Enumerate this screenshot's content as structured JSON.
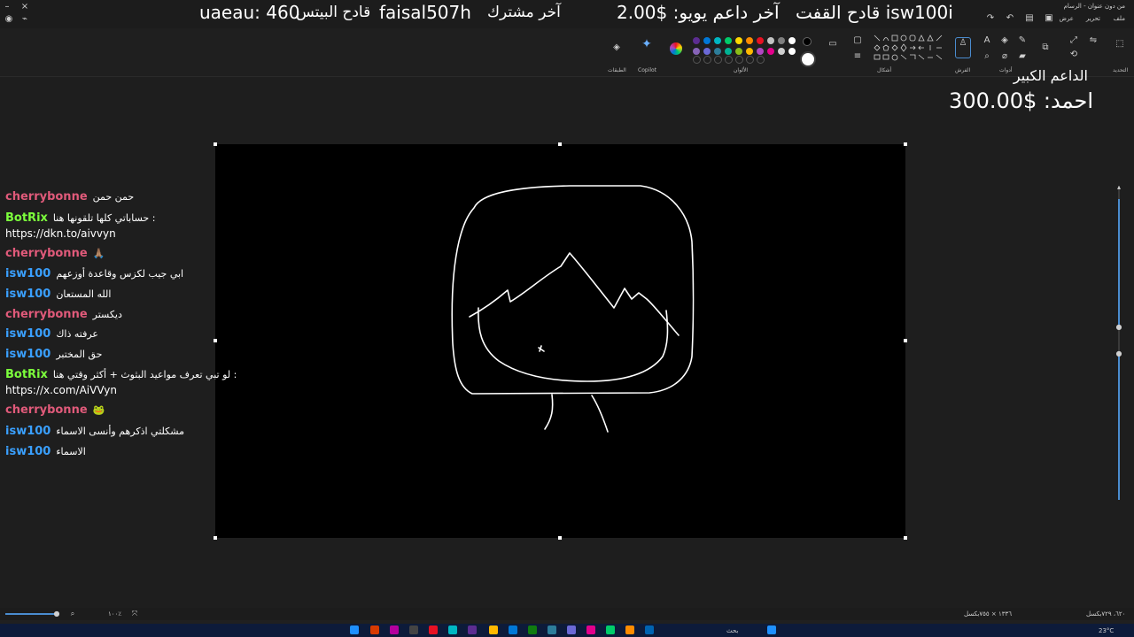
{
  "ticker": {
    "item1": "قادح القفت isw100i",
    "item2": "آخر داعم  يويو: $2.00",
    "item3": "آخر مشترك",
    "item4": "faisal507h",
    "item5": "قادح البيتس",
    "item6": "uaeau: 460"
  },
  "window": {
    "title": "من دون عنوان - الرسام",
    "menu": [
      "ملف",
      "تحرير",
      "عرض"
    ]
  },
  "ribbon": {
    "groups": {
      "selection": "التحديد",
      "tools": "أدوات",
      "brushes": "الفرش",
      "shapes": "أشكال",
      "colors": "الألوان",
      "copilot": "Copilot",
      "layers": "الطبقات"
    },
    "palette_row1": [
      "#ffffff",
      "#000000",
      "#7f7f7f",
      "#c3c3c3",
      "#e81123",
      "#ff8c00",
      "#ffd800",
      "#00cc6a",
      "#10893e",
      "#00b7c3",
      "#0078d7",
      "#5c2d91",
      "#b146c2",
      "#e3008c"
    ],
    "active_color": "#ffffff",
    "secondary_color": "#000000"
  },
  "donor": {
    "title": "الداعم الكبير",
    "value": "احمد: $300.00"
  },
  "chat": [
    {
      "user": "cherrybonne",
      "color": "#e05a7a",
      "msg": "حمن حمن"
    },
    {
      "user": "BotRix",
      "color": "#7cff3c",
      "msg": "حساباتي كلها تلقونها هنا :",
      "link": "https://dkn.to/aivvyn"
    },
    {
      "user": "cherrybonne",
      "color": "#e05a7a",
      "msg": "🙏🏽"
    },
    {
      "user": "isw100",
      "color": "#3aa0ff",
      "msg": "ابي جيب لكزس وقاعدة أوزعهم"
    },
    {
      "user": "isw100",
      "color": "#3aa0ff",
      "msg": "الله المستعان"
    },
    {
      "user": "cherrybonne",
      "color": "#e05a7a",
      "msg": "ديكستر"
    },
    {
      "user": "isw100",
      "color": "#3aa0ff",
      "msg": "عرفته ذاك"
    },
    {
      "user": "isw100",
      "color": "#3aa0ff",
      "msg": "حق المختبر"
    },
    {
      "user": "BotRix",
      "color": "#7cff3c",
      "msg": "لو تبي تعرف مواعيد البثوث + أكثر وقتي هنا :",
      "link": "https://x.com/AiVVyn"
    },
    {
      "user": "cherrybonne",
      "color": "#e05a7a",
      "msg": "🐸"
    },
    {
      "user": "isw100",
      "color": "#3aa0ff",
      "msg": "مشكلتي اذكرهم وأنسى الاسماء"
    },
    {
      "user": "isw100",
      "color": "#3aa0ff",
      "msg": "الاسماء"
    }
  ],
  "status": {
    "zoom": "١٠٠٪",
    "canvas_size": "١٣٣٦ × ٧٥٥بكسل",
    "cursor": "٦٢٠، ٧٢٩بكسل"
  },
  "taskbar": {
    "temp": "23°C",
    "search": "بحث"
  }
}
